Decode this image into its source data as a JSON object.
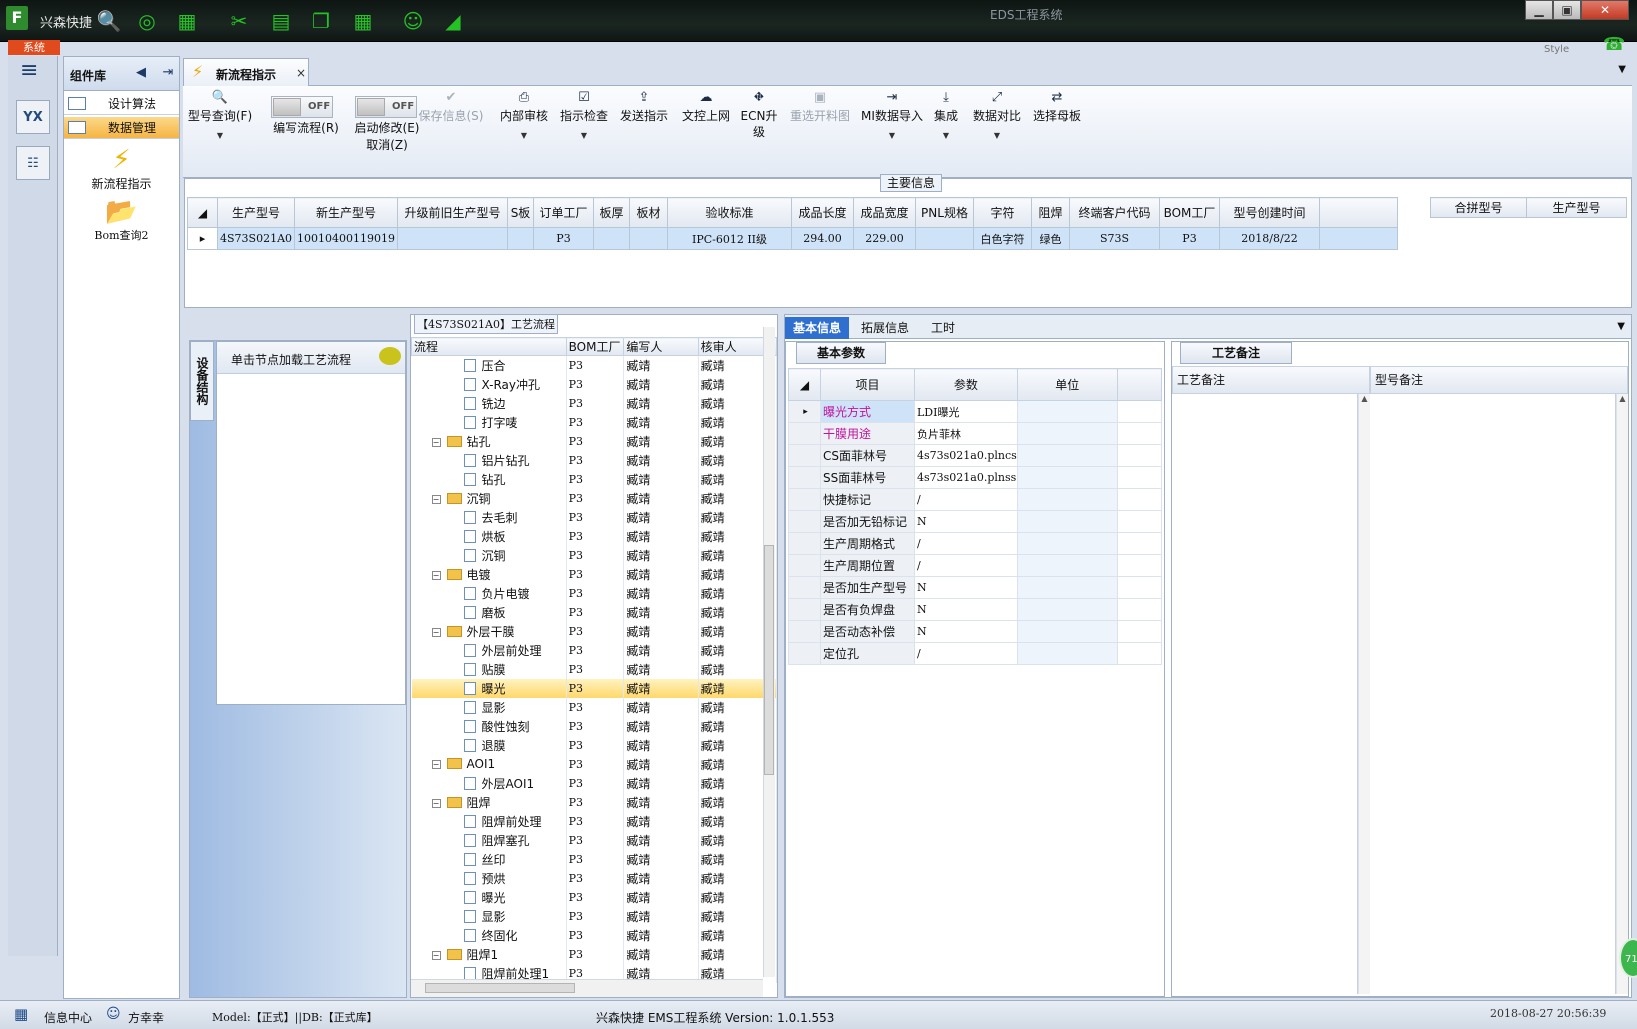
{
  "app": {
    "logo": "F",
    "name": "兴森快捷",
    "title": "EDS工程系统",
    "system_tab": "系统",
    "style_label": "Style"
  },
  "quick_icons": [
    "search-icon",
    "lifebuoy-icon",
    "spreadsheet-icon",
    "scissors-icon",
    "film-icon",
    "copy-icon",
    "grid-icon",
    "user-icon",
    "area-chart-icon"
  ],
  "window_buttons": {
    "minimize": "▁",
    "restore": "▣",
    "close": "✕"
  },
  "left_strip": {
    "yx_label": "YX"
  },
  "component_panel": {
    "title": "组件库",
    "menu": [
      {
        "label": "设计算法",
        "selected": false
      },
      {
        "label": "数据管理",
        "selected": true
      }
    ],
    "modules": [
      {
        "label": "新流程指示",
        "icon": "lightning-icon"
      },
      {
        "label": "Bom查询2",
        "icon": "folder-icon"
      }
    ]
  },
  "doc_tab": {
    "label": "新流程指示",
    "close": "×"
  },
  "ribbon": {
    "type_query": "型号查询(F)",
    "toggle_write": {
      "state": "OFF",
      "label": "编写流程(R)"
    },
    "toggle_enable": {
      "state": "OFF",
      "label1": "启动修改(E)",
      "label2": "取消(Z)"
    },
    "buttons": [
      {
        "label": "保存信息(S)",
        "icon": "check-icon",
        "disabled": true,
        "dropdown": false
      },
      {
        "label": "内部审核",
        "icon": "printer-icon",
        "disabled": false,
        "dropdown": true
      },
      {
        "label": "指示检查",
        "icon": "checkbox-icon",
        "disabled": false,
        "dropdown": true
      },
      {
        "label": "发送指示",
        "icon": "upload-icon",
        "disabled": false,
        "dropdown": false
      },
      {
        "label": "文控上网",
        "icon": "cloud-upload-icon",
        "disabled": false,
        "dropdown": false
      },
      {
        "label": "ECN升级",
        "icon": "road-icon",
        "disabled": false,
        "dropdown": false
      },
      {
        "label": "重选开料图",
        "icon": "image-icon",
        "disabled": true,
        "dropdown": false
      },
      {
        "label": "MI数据导入",
        "icon": "import-icon",
        "disabled": false,
        "dropdown": true
      },
      {
        "label": "集成",
        "icon": "download-icon",
        "disabled": false,
        "dropdown": true
      },
      {
        "label": "数据对比",
        "icon": "compress-icon",
        "disabled": false,
        "dropdown": true
      },
      {
        "label": "选择母板",
        "icon": "shuffle-icon",
        "disabled": false,
        "dropdown": false
      }
    ]
  },
  "main_info": {
    "title": "主要信息",
    "columns": [
      "生产型号",
      "新生产型号",
      "升级前旧生产型号",
      "S板",
      "订单工厂",
      "板厚",
      "板材",
      "验收标准",
      "成品长度",
      "成品宽度",
      "PNL规格",
      "字符",
      "阻焊",
      "终端客户代码",
      "BOM工厂",
      "型号创建时间"
    ],
    "row": [
      "4S73S021A0",
      "10010400119019",
      "",
      "",
      "P3",
      "",
      "",
      "IPC-6012 II级",
      "294.00",
      "229.00",
      "",
      "白色字符",
      "绿色",
      "S73S",
      "P3",
      "2018/8/22"
    ],
    "side_columns": [
      "合拼型号",
      "生产型号"
    ]
  },
  "left_lower": {
    "vertical_tab": "设备结构",
    "click_hint": "单击节点加载工艺流程"
  },
  "tree": {
    "title": "【4S73S021A0】工艺流程",
    "columns": [
      "流程",
      "BOM工厂",
      "编写人",
      "核审人"
    ],
    "rows": [
      {
        "label": "压合",
        "kind": "leaf",
        "bom": "P3",
        "writer": "臧靖",
        "reviewer": "臧靖"
      },
      {
        "label": "X-Ray冲孔",
        "kind": "leaf",
        "bom": "P3",
        "writer": "臧靖",
        "reviewer": "臧靖"
      },
      {
        "label": "铣边",
        "kind": "leaf",
        "bom": "P3",
        "writer": "臧靖",
        "reviewer": "臧靖"
      },
      {
        "label": "打字唛",
        "kind": "leaf",
        "bom": "P3",
        "writer": "臧靖",
        "reviewer": "臧靖"
      },
      {
        "label": "钻孔",
        "kind": "folder",
        "bom": "P3",
        "writer": "臧靖",
        "reviewer": "臧靖"
      },
      {
        "label": "铝片钻孔",
        "kind": "leaf",
        "bom": "P3",
        "writer": "臧靖",
        "reviewer": "臧靖"
      },
      {
        "label": "钻孔",
        "kind": "leaf",
        "bom": "P3",
        "writer": "臧靖",
        "reviewer": "臧靖"
      },
      {
        "label": "沉铜",
        "kind": "folder",
        "bom": "P3",
        "writer": "臧靖",
        "reviewer": "臧靖"
      },
      {
        "label": "去毛刺",
        "kind": "leaf",
        "bom": "P3",
        "writer": "臧靖",
        "reviewer": "臧靖"
      },
      {
        "label": "烘板",
        "kind": "leaf",
        "bom": "P3",
        "writer": "臧靖",
        "reviewer": "臧靖"
      },
      {
        "label": "沉铜",
        "kind": "leaf",
        "bom": "P3",
        "writer": "臧靖",
        "reviewer": "臧靖"
      },
      {
        "label": "电镀",
        "kind": "folder",
        "bom": "P3",
        "writer": "臧靖",
        "reviewer": "臧靖"
      },
      {
        "label": "负片电镀",
        "kind": "leaf",
        "bom": "P3",
        "writer": "臧靖",
        "reviewer": "臧靖"
      },
      {
        "label": "磨板",
        "kind": "leaf",
        "bom": "P3",
        "writer": "臧靖",
        "reviewer": "臧靖"
      },
      {
        "label": "外层干膜",
        "kind": "folder",
        "bom": "P3",
        "writer": "臧靖",
        "reviewer": "臧靖"
      },
      {
        "label": "外层前处理",
        "kind": "leaf",
        "bom": "P3",
        "writer": "臧靖",
        "reviewer": "臧靖"
      },
      {
        "label": "贴膜",
        "kind": "leaf",
        "bom": "P3",
        "writer": "臧靖",
        "reviewer": "臧靖"
      },
      {
        "label": "曝光",
        "kind": "leaf",
        "bom": "P3",
        "writer": "臧靖",
        "reviewer": "臧靖",
        "selected": true
      },
      {
        "label": "显影",
        "kind": "leaf",
        "bom": "P3",
        "writer": "臧靖",
        "reviewer": "臧靖"
      },
      {
        "label": "酸性蚀刻",
        "kind": "leaf",
        "bom": "P3",
        "writer": "臧靖",
        "reviewer": "臧靖"
      },
      {
        "label": "退膜",
        "kind": "leaf",
        "bom": "P3",
        "writer": "臧靖",
        "reviewer": "臧靖"
      },
      {
        "label": "AOI1",
        "kind": "folder",
        "bom": "P3",
        "writer": "臧靖",
        "reviewer": "臧靖"
      },
      {
        "label": "外层AOI1",
        "kind": "leaf",
        "bom": "P3",
        "writer": "臧靖",
        "reviewer": "臧靖"
      },
      {
        "label": "阻焊",
        "kind": "folder",
        "bom": "P3",
        "writer": "臧靖",
        "reviewer": "臧靖"
      },
      {
        "label": "阻焊前处理",
        "kind": "leaf",
        "bom": "P3",
        "writer": "臧靖",
        "reviewer": "臧靖"
      },
      {
        "label": "阻焊塞孔",
        "kind": "leaf",
        "bom": "P3",
        "writer": "臧靖",
        "reviewer": "臧靖"
      },
      {
        "label": "丝印",
        "kind": "leaf",
        "bom": "P3",
        "writer": "臧靖",
        "reviewer": "臧靖"
      },
      {
        "label": "预烘",
        "kind": "leaf",
        "bom": "P3",
        "writer": "臧靖",
        "reviewer": "臧靖"
      },
      {
        "label": "曝光",
        "kind": "leaf",
        "bom": "P3",
        "writer": "臧靖",
        "reviewer": "臧靖"
      },
      {
        "label": "显影",
        "kind": "leaf",
        "bom": "P3",
        "writer": "臧靖",
        "reviewer": "臧靖"
      },
      {
        "label": "终固化",
        "kind": "leaf",
        "bom": "P3",
        "writer": "臧靖",
        "reviewer": "臧靖"
      },
      {
        "label": "阻焊1",
        "kind": "folder",
        "bom": "P3",
        "writer": "臧靖",
        "reviewer": "臧靖"
      },
      {
        "label": "阻焊前处理1",
        "kind": "leaf",
        "bom": "P3",
        "writer": "臧靖",
        "reviewer": "臧靖"
      }
    ]
  },
  "right_tabs": [
    "基本信息",
    "拓展信息",
    "工时"
  ],
  "basic_params": {
    "title": "基本参数",
    "columns": [
      "项目",
      "参数",
      "单位"
    ],
    "rows": [
      {
        "item": "曝光方式",
        "value": "LDI曝光",
        "style": "pink-hl"
      },
      {
        "item": "干膜用途",
        "value": "负片菲林",
        "style": "pink"
      },
      {
        "item": "CS面菲林号",
        "value": "4s73s021a0.plncs",
        "style": ""
      },
      {
        "item": "SS面菲林号",
        "value": "4s73s021a0.plnss",
        "style": ""
      },
      {
        "item": "快捷标记",
        "value": "/",
        "style": ""
      },
      {
        "item": "是否加无铅标记",
        "value": "N",
        "style": ""
      },
      {
        "item": "生产周期格式",
        "value": "/",
        "style": ""
      },
      {
        "item": "生产周期位置",
        "value": "/",
        "style": ""
      },
      {
        "item": "是否加生产型号",
        "value": "N",
        "style": ""
      },
      {
        "item": "是否有负焊盘",
        "value": "N",
        "style": ""
      },
      {
        "item": "是否动态补偿",
        "value": "N",
        "style": ""
      },
      {
        "item": "定位孔",
        "value": "/",
        "style": ""
      }
    ]
  },
  "process_notes": {
    "title": "工艺备注",
    "col1": "工艺备注",
    "col2": "型号备注"
  },
  "status": {
    "info_center": "信息中心",
    "user": "方幸幸",
    "model_db": "Model:【正式】||DB:【正式库】",
    "version": "兴森快捷 EMS工程系统 Version: 1.0.1.553",
    "datetime": "2018-08-27 20:56:39",
    "badge": "71"
  }
}
